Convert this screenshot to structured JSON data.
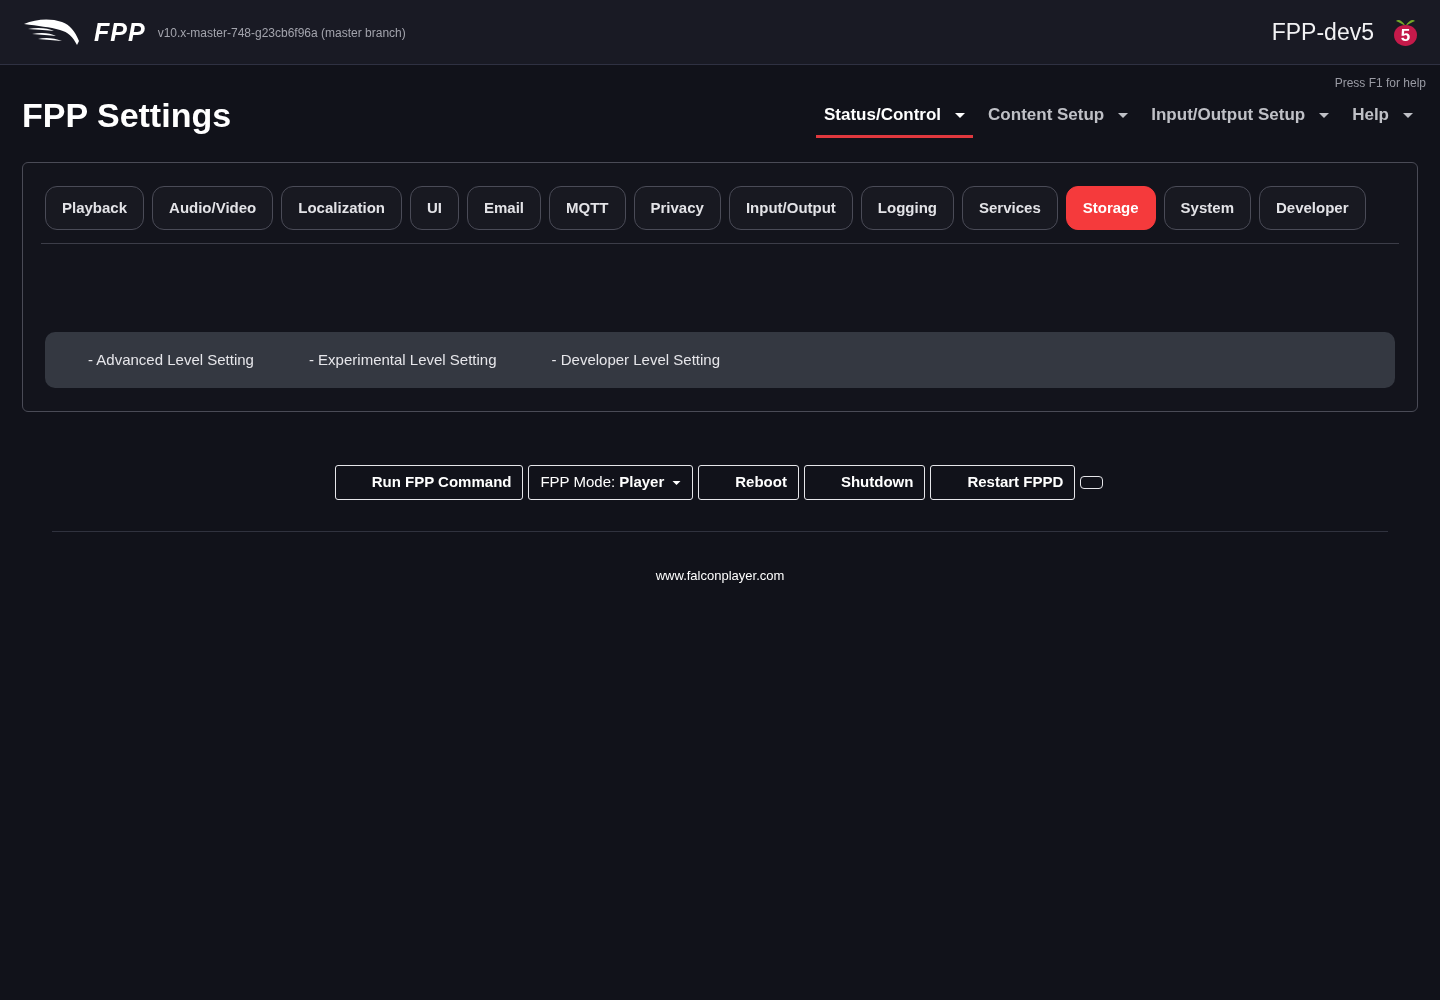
{
  "header": {
    "logo_text": "FPP",
    "version": "v10.x-master-748-g23cb6f96a (master branch)",
    "hostname": "FPP-dev5",
    "board_model": "5"
  },
  "help_hint": "Press F1 for help",
  "page_title": "FPP Settings",
  "nav": [
    {
      "label": "Status/Control",
      "selected": true
    },
    {
      "label": "Content Setup",
      "selected": false
    },
    {
      "label": "Input/Output Setup",
      "selected": false
    },
    {
      "label": "Help",
      "selected": false
    }
  ],
  "settings_tabs": [
    {
      "label": "Playback",
      "selected": false
    },
    {
      "label": "Audio/Video",
      "selected": false
    },
    {
      "label": "Localization",
      "selected": false
    },
    {
      "label": "UI",
      "selected": false
    },
    {
      "label": "Email",
      "selected": false
    },
    {
      "label": "MQTT",
      "selected": false
    },
    {
      "label": "Privacy",
      "selected": false
    },
    {
      "label": "Input/Output",
      "selected": false
    },
    {
      "label": "Logging",
      "selected": false
    },
    {
      "label": "Services",
      "selected": false
    },
    {
      "label": "Storage",
      "selected": true
    },
    {
      "label": "System",
      "selected": false
    },
    {
      "label": "Developer",
      "selected": false
    }
  ],
  "legend": [
    "- Advanced Level Setting",
    "- Experimental Level Setting",
    "- Developer Level Setting"
  ],
  "controls": [
    {
      "kind": "button",
      "label": "Run FPP Command"
    },
    {
      "kind": "dropdown",
      "label": "FPP Mode:",
      "value": "Player"
    },
    {
      "kind": "button",
      "label": "Reboot"
    },
    {
      "kind": "button",
      "label": "Shutdown"
    },
    {
      "kind": "button",
      "label": "Restart FPPD"
    },
    {
      "kind": "blank"
    }
  ],
  "footer": {
    "link": "www.falconplayer.com"
  }
}
